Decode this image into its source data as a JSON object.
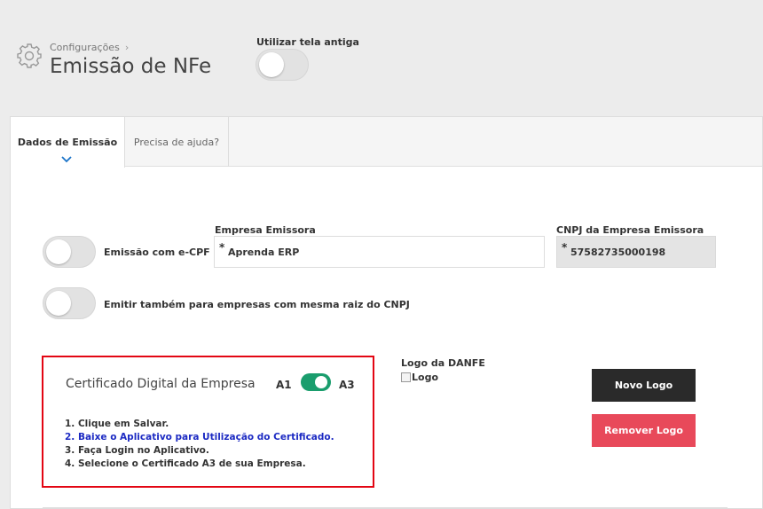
{
  "header": {
    "breadcrumb": "Configurações",
    "breadcrumb_chevron": "›",
    "title": "Emissão de NFe",
    "old_screen_label": "Utilizar tela antiga",
    "old_screen_toggle_on": false
  },
  "tabs": [
    {
      "label": "Dados de Emissão",
      "active": true
    },
    {
      "label": "Precisa de ajuda?",
      "active": false
    }
  ],
  "form": {
    "ecpf_label": "Emissão com e-CPF",
    "ecpf_on": false,
    "same_root_label": "Emitir também para empresas com mesma raiz do CNPJ",
    "same_root_on": false,
    "company_label": "Empresa Emissora",
    "company_required": "*",
    "company_value": "Aprenda ERP",
    "cnpj_label": "CNPJ da Empresa Emissora",
    "cnpj_required": "*",
    "cnpj_value": "57582735000198"
  },
  "certificate": {
    "title": "Certificado Digital da Empresa",
    "option_a1": "A1",
    "option_a3": "A3",
    "selected": "A3",
    "steps": [
      "1. Clique em Salvar.",
      "2. Baixe o Aplicativo para Utilização do Certificado.",
      "3. Faça Login no Aplicativo.",
      "4. Selecione o Certificado A3 de sua Empresa."
    ],
    "link_color": "#1d2bc3",
    "border_color": "#e30613",
    "toggle_color": "#1a9d6d"
  },
  "logo": {
    "label": "Logo da DANFE",
    "alt": "Logo",
    "new_button": "Novo Logo",
    "remove_button": "Remover Logo",
    "new_button_color": "#2a2a2a",
    "remove_button_color": "#e8495a"
  },
  "icons": {
    "settings": "gear-icon",
    "tab_indicator": "chevron-down-icon",
    "broken_image": "broken-image-icon"
  }
}
